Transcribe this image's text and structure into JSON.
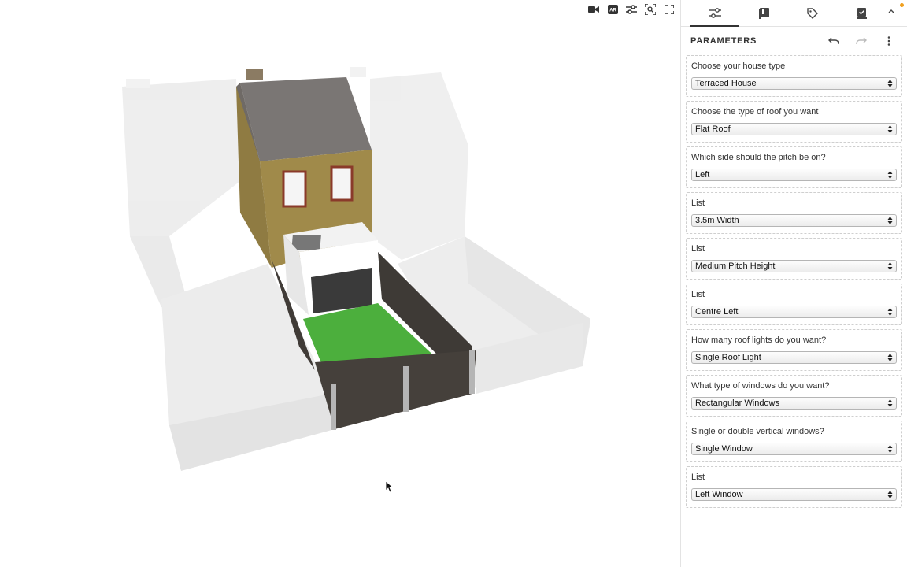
{
  "viewport": {
    "toolbar": [
      {
        "name": "camera-icon"
      },
      {
        "name": "ar-icon",
        "label": "AR"
      },
      {
        "name": "sliders-icon"
      },
      {
        "name": "zoom-extents-icon"
      },
      {
        "name": "fullscreen-icon"
      }
    ]
  },
  "panel": {
    "tabs": [
      {
        "name": "tab-parameters",
        "icon": "sliders-icon",
        "active": true
      },
      {
        "name": "tab-library",
        "icon": "book-icon",
        "active": false
      },
      {
        "name": "tab-tags",
        "icon": "tag-icon",
        "active": false
      },
      {
        "name": "tab-export",
        "icon": "download-check-icon",
        "active": false
      }
    ],
    "title": "PARAMETERS",
    "parameters": [
      {
        "label": "Choose your house type",
        "value": "Terraced House"
      },
      {
        "label": "Choose the type of roof you want",
        "value": "Flat Roof"
      },
      {
        "label": "Which side should the pitch be on?",
        "value": "Left"
      },
      {
        "label": "List",
        "value": "3.5m Width"
      },
      {
        "label": "List",
        "value": "Medium Pitch Height"
      },
      {
        "label": "List",
        "value": "Centre Left"
      },
      {
        "label": "How many roof lights do you want?",
        "value": "Single Roof Light"
      },
      {
        "label": "What type of windows do you want?",
        "value": "Rectangular Windows"
      },
      {
        "label": "Single or double vertical windows?",
        "value": "Single Window"
      },
      {
        "label": "List",
        "value": "Left Window"
      }
    ]
  },
  "colors": {
    "accent": "#333333",
    "notify": "#f0a020",
    "grass": "#4caf3d",
    "brick": "#a08a4a",
    "roof": "#7a7674"
  }
}
